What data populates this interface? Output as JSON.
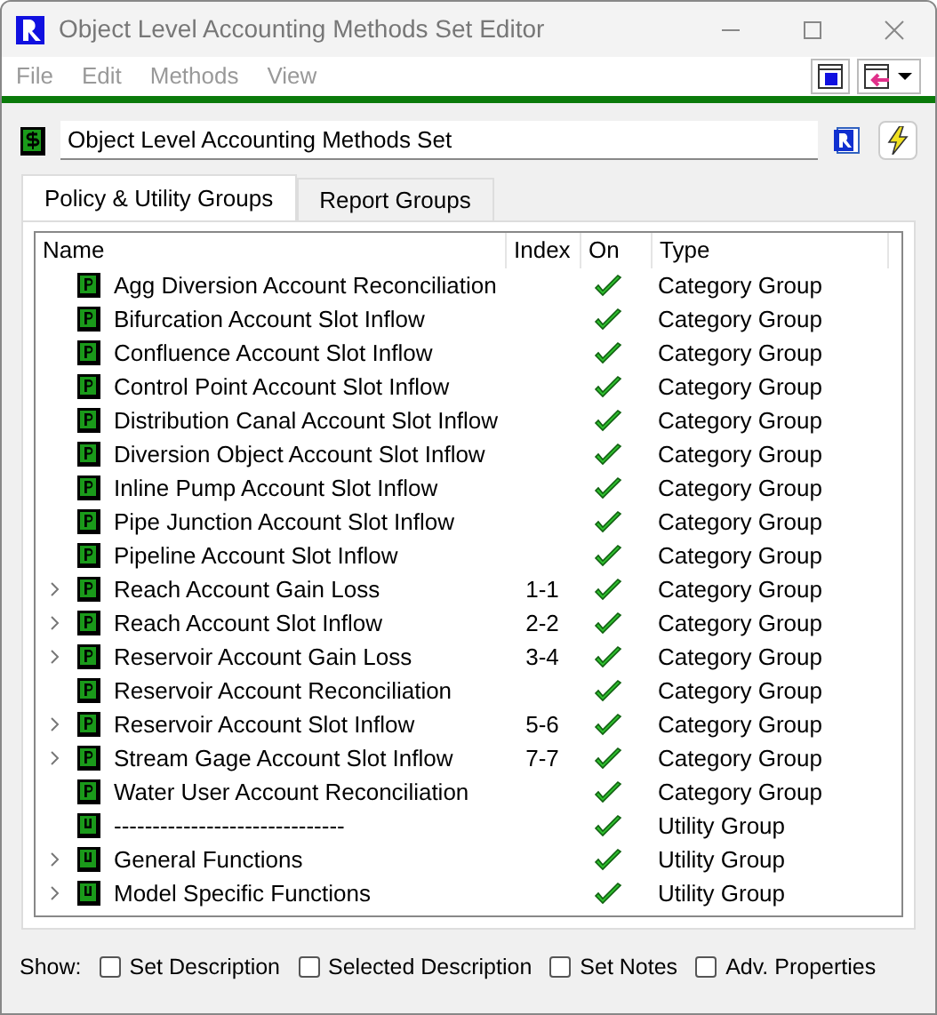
{
  "window": {
    "title": "Object Level Accounting Methods Set Editor"
  },
  "menu": [
    "File",
    "Edit",
    "Methods",
    "View"
  ],
  "set_name": {
    "value": "Object Level Accounting Methods Set"
  },
  "tabs": [
    {
      "label": "Policy & Utility Groups",
      "selected": true
    },
    {
      "label": "Report Groups",
      "selected": false
    }
  ],
  "table": {
    "columns": [
      "Name",
      "Index",
      "On",
      "Type"
    ],
    "rows": [
      {
        "kind": "policy",
        "name": "Agg Diversion Account Reconciliation",
        "index": "",
        "on": true,
        "type": "Category Group",
        "expandable": false
      },
      {
        "kind": "policy",
        "name": "Bifurcation Account Slot Inflow",
        "index": "",
        "on": true,
        "type": "Category Group",
        "expandable": false
      },
      {
        "kind": "policy",
        "name": "Confluence Account Slot Inflow",
        "index": "",
        "on": true,
        "type": "Category Group",
        "expandable": false
      },
      {
        "kind": "policy",
        "name": "Control Point Account Slot Inflow",
        "index": "",
        "on": true,
        "type": "Category Group",
        "expandable": false
      },
      {
        "kind": "policy",
        "name": "Distribution Canal Account Slot Inflow",
        "index": "",
        "on": true,
        "type": "Category Group",
        "expandable": false
      },
      {
        "kind": "policy",
        "name": "Diversion Object Account Slot Inflow",
        "index": "",
        "on": true,
        "type": "Category Group",
        "expandable": false
      },
      {
        "kind": "policy",
        "name": "Inline Pump Account Slot Inflow",
        "index": "",
        "on": true,
        "type": "Category Group",
        "expandable": false
      },
      {
        "kind": "policy",
        "name": "Pipe Junction Account Slot Inflow",
        "index": "",
        "on": true,
        "type": "Category Group",
        "expandable": false
      },
      {
        "kind": "policy",
        "name": "Pipeline Account Slot Inflow",
        "index": "",
        "on": true,
        "type": "Category Group",
        "expandable": false
      },
      {
        "kind": "policy",
        "name": "Reach Account Gain Loss",
        "index": "1-1",
        "on": true,
        "type": "Category Group",
        "expandable": true
      },
      {
        "kind": "policy",
        "name": "Reach Account Slot Inflow",
        "index": "2-2",
        "on": true,
        "type": "Category Group",
        "expandable": true
      },
      {
        "kind": "policy",
        "name": "Reservoir Account Gain Loss",
        "index": "3-4",
        "on": true,
        "type": "Category Group",
        "expandable": true
      },
      {
        "kind": "policy",
        "name": "Reservoir Account Reconciliation",
        "index": "",
        "on": true,
        "type": "Category Group",
        "expandable": false
      },
      {
        "kind": "policy",
        "name": "Reservoir Account Slot Inflow",
        "index": "5-6",
        "on": true,
        "type": "Category Group",
        "expandable": true
      },
      {
        "kind": "policy",
        "name": "Stream Gage Account Slot Inflow",
        "index": "7-7",
        "on": true,
        "type": "Category Group",
        "expandable": true
      },
      {
        "kind": "policy",
        "name": "Water User Account Reconciliation",
        "index": "",
        "on": true,
        "type": "Category Group",
        "expandable": false
      },
      {
        "kind": "utility",
        "name": "------------------------------",
        "index": "",
        "on": true,
        "type": "Utility Group",
        "expandable": false
      },
      {
        "kind": "utility",
        "name": "General Functions",
        "index": "",
        "on": true,
        "type": "Utility Group",
        "expandable": true
      },
      {
        "kind": "utility",
        "name": "Model Specific Functions",
        "index": "",
        "on": true,
        "type": "Utility Group",
        "expandable": true
      }
    ]
  },
  "show": {
    "label": "Show:",
    "options": [
      {
        "label": "Set Description",
        "checked": false
      },
      {
        "label": "Selected Description",
        "checked": false
      },
      {
        "label": "Set Notes",
        "checked": false
      },
      {
        "label": "Adv. Properties",
        "checked": false
      }
    ]
  }
}
